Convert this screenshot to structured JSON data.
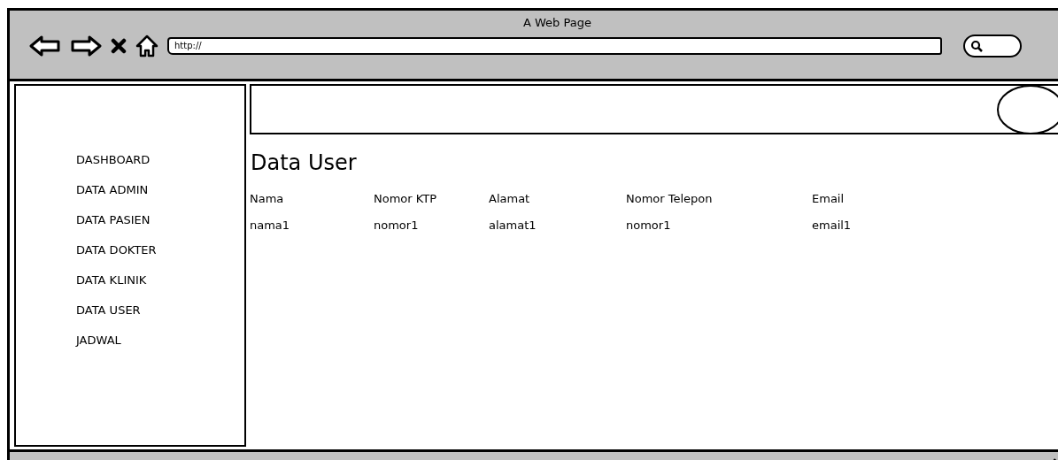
{
  "window": {
    "title": "A Web Page"
  },
  "address_bar": {
    "value": "http://"
  },
  "sidebar": {
    "items": [
      {
        "label": "DASHBOARD"
      },
      {
        "label": "DATA ADMIN"
      },
      {
        "label": "DATA PASIEN"
      },
      {
        "label": "DATA DOKTER"
      },
      {
        "label": "DATA KLINIK"
      },
      {
        "label": "DATA USER"
      },
      {
        "label": "JADWAL"
      }
    ]
  },
  "main": {
    "heading": "Data User",
    "table": {
      "columns": [
        "Nama",
        "Nomor KTP",
        "Alamat",
        "Nomor Telepon",
        "Email"
      ],
      "rows": [
        [
          "nama1",
          "nomor1",
          "alamat1",
          "nomor1",
          "email1"
        ]
      ]
    }
  }
}
